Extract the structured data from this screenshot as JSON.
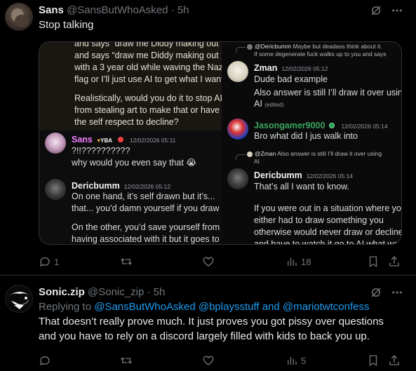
{
  "colors": {
    "bg": "#000000",
    "text": "#e7e9ea",
    "muted": "#71767b",
    "link": "#1d9bf0",
    "divider": "#2f3336"
  },
  "tweet1": {
    "name": "Sans",
    "handle": "@SansButWhoAsked",
    "dot": "·",
    "time": "5h",
    "text": "Stop talking",
    "avatar_icon": "avatar-photo",
    "counts": {
      "reply": "1",
      "retweet": "",
      "like": "",
      "views": "18"
    },
    "embed": {
      "left_lines": [
        "and says “draw me Diddy making out",
        "with a 3 year old while waving the Nazi",
        "flag or I’ll just use AI to get what I want.”",
        "Realistically, would you do it to stop AI",
        "from stealing art to make that or have",
        "the self respect to decline?"
      ],
      "sans_msg": {
        "name": "Sans",
        "badge": "YBA",
        "time": "12/02/2026 05:11",
        "line1": "?!!??????????",
        "line2": "why would you even say that",
        "emoji": "😭"
      },
      "deric_left": {
        "name": "Dericbumm",
        "time": "12/02/2026 05:12",
        "lines": [
          "On one hand, it’s self drawn but it’s...",
          "that... you’d damn yourself if you draw it.",
          "On the other, you’d save yourself from",
          "having associated with it but it goes to"
        ]
      },
      "right_reply1": {
        "who": "@Dericbumm",
        "text": "Maybe but deadass think about it.",
        "line2": "If some degenerate fuck walks up to you and says"
      },
      "zman": {
        "name": "Zman",
        "time": "12/02/2026 05:12",
        "line1": "Dude bad example",
        "line2": "Also answer is still I’ll draw it over using",
        "line3": "AI",
        "edited": "(edited)"
      },
      "jason": {
        "name": "Jasongamer9000",
        "time": "12/02/2026 05:14",
        "line1": "Bro what did I jus walk into"
      },
      "right_reply2": {
        "who": "@Zman",
        "text": "Also answer is still I’ll draw it over using",
        "line2": "AI"
      },
      "deric_right": {
        "name": "Dericbumm",
        "time": "12/02/2026 05:14",
        "line1": "That’s all I want to know.",
        "lines": [
          "If you were out in a situation where you",
          "either had to draw something you",
          "otherwise would never draw or decline",
          "and have to watch it go to AI what would"
        ]
      }
    }
  },
  "tweet2": {
    "name": "Sonic.zip",
    "handle": "@Sonic_zip",
    "dot": "·",
    "time": "5h",
    "replying_prefix": "Replying to",
    "mention1": "@SansButWhoAsked",
    "mention2": "@bplaysstuff",
    "and": "and",
    "mention3": "@mariotwtconfess",
    "line1": "That doesn’t really prove much. It just proves you got pissy over questions",
    "line2": "and you have to rely on a discord largely filled with kids to back you up.",
    "counts": {
      "reply": "",
      "retweet": "",
      "like": "",
      "views": "5"
    }
  }
}
